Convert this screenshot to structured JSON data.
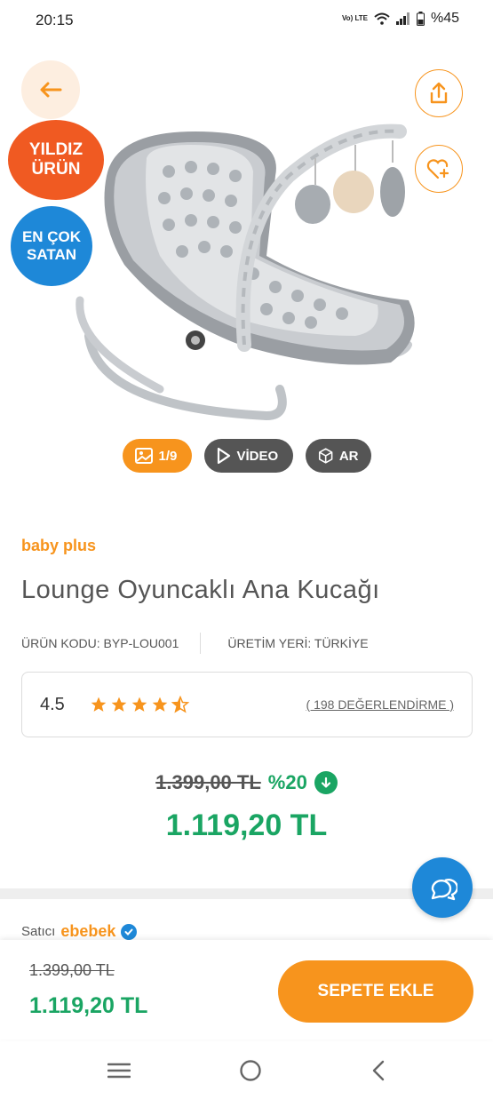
{
  "status_bar": {
    "time": "20:15",
    "network_label": "Vo) LTE",
    "battery": "%45"
  },
  "gallery": {
    "back_icon": "arrow-left-icon",
    "badge_star": "YILDIZ ÜRÜN",
    "badge_best": "EN ÇOK SATAN",
    "share_icon": "share-icon",
    "favorite_icon": "heart-plus-icon",
    "image_counter": "1/9",
    "video_label": "VİDEO",
    "ar_label": "AR"
  },
  "product": {
    "brand": "baby plus",
    "title": "Lounge Oyuncaklı Ana Kucağı",
    "code": "ÜRÜN KODU: BYP-LOU001",
    "origin": "ÜRETİM YERİ: TÜRKİYE",
    "rating": "4.5",
    "rating_value": 4.5,
    "reviews": "( 198 DEĞERLENDİRME )"
  },
  "price": {
    "old": "1.399,00 TL",
    "discount": "%20",
    "new": "1.119,20 TL"
  },
  "seller": {
    "label": "Satıcı",
    "name": "ebebek"
  },
  "bottom_bar": {
    "old": "1.399,00 TL",
    "new": "1.119,20 TL",
    "cart_label": "SEPETE EKLE"
  },
  "colors": {
    "accent_orange": "#f7941d",
    "price_green": "#1aa563",
    "badge_red": "#f05a22",
    "badge_blue": "#1e88d8"
  }
}
